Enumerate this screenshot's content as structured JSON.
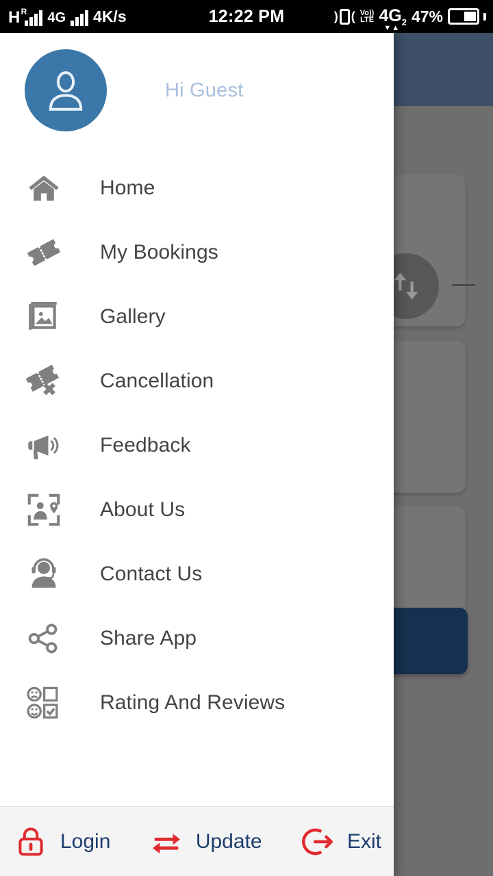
{
  "status_bar": {
    "network_type": "H",
    "roaming": "R",
    "data_network": "4G",
    "data_rate": "4K/s",
    "time": "12:22 PM",
    "volte_top": "Vo))",
    "volte_bottom": "LTE",
    "sim_network": "4G",
    "sim_index": "2",
    "battery_percent": "47%",
    "icons": [
      "signal-bars-icon",
      "signal-bars-icon",
      "vibrate-icon",
      "volte-icon",
      "battery-icon"
    ]
  },
  "drawer": {
    "profile": {
      "greeting": "Hi Guest",
      "avatar_icon": "user-avatar-icon",
      "avatar_color": "#3b77a8",
      "greeting_color": "#a9c0dd"
    },
    "menu_items": [
      {
        "label": "Home",
        "icon": "home-icon"
      },
      {
        "label": "My Bookings",
        "icon": "ticket-icon"
      },
      {
        "label": "Gallery",
        "icon": "gallery-image-icon"
      },
      {
        "label": "Cancellation",
        "icon": "ticket-cancel-icon"
      },
      {
        "label": "Feedback",
        "icon": "megaphone-icon"
      },
      {
        "label": "About Us",
        "icon": "person-location-frame-icon"
      },
      {
        "label": "Contact Us",
        "icon": "headset-support-icon"
      },
      {
        "label": "Share App",
        "icon": "share-nodes-icon"
      },
      {
        "label": "Rating And Reviews",
        "icon": "rating-faces-checkbox-icon"
      }
    ],
    "bottom_actions": [
      {
        "label": "Login",
        "icon": "lock-icon",
        "icon_color": "#e02a2f",
        "label_color": "#1d3d6e"
      },
      {
        "label": "Update",
        "icon": "sync-arrows-icon",
        "icon_color": "#e02a2f",
        "label_color": "#1d3d6e"
      },
      {
        "label": "Exit",
        "icon": "exit-arrow-icon",
        "icon_color": "#e02a2f",
        "label_color": "#1d3d6e"
      }
    ]
  },
  "background_app": {
    "appbar_color": "#3d5068",
    "scrim_color": "#6e6e6e",
    "primary_button_color": "#16304f",
    "transfer_icon": "transfer-up-down-icon"
  }
}
